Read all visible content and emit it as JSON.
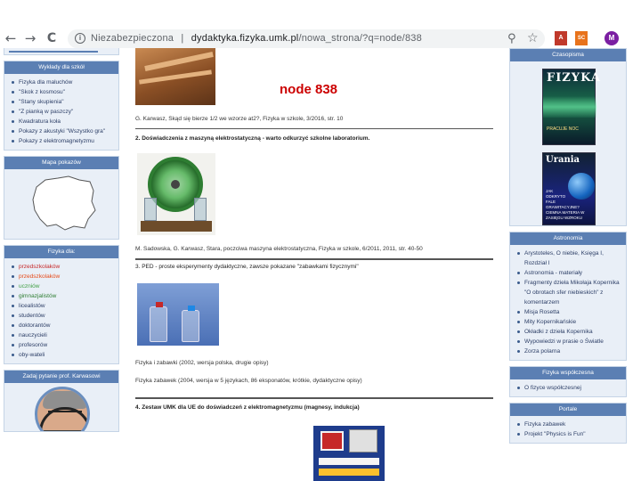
{
  "browser": {
    "nav_back": "←",
    "nav_forward": "→",
    "nav_reload": "C",
    "security_label": "Niezabezpieczona",
    "separator": "|",
    "url_host": "dydaktyka.fizyka.umk.pl",
    "url_path": "/nowa_strona/?q=node/838",
    "search_glyph": "⚲",
    "star_glyph": "☆",
    "profile_letter": "M",
    "ext1_label": "A",
    "ext2_label": "SC"
  },
  "left": {
    "wyklady": {
      "title": "Wykłady dla szkół",
      "items": [
        "Fizyka dla maluchów",
        "\"Skok z kosmosu\"",
        "\"Stany skupienia\"",
        "\"Z pianką w paszczy\"",
        "Kwadratura koła",
        "Pokazy z akustyki \"Wszystko gra\"",
        "Pokazy z elektromagnetyzmu"
      ]
    },
    "mapa": {
      "title": "Mapa pokazów"
    },
    "fizyka_dla": {
      "title": "Fizyka dla:",
      "items": [
        {
          "label": "przedszkolaków",
          "color": "#c62828"
        },
        {
          "label": "przedszkolaków",
          "color": "#e64a19"
        },
        {
          "label": "uczniów",
          "color": "#43a047"
        },
        {
          "label": "gimnazjalistów",
          "color": "#2e7d32"
        },
        {
          "label": "licealistów",
          "color": "#2c3e66"
        },
        {
          "label": "studentów",
          "color": "#2c3e66"
        },
        {
          "label": "doktorantów",
          "color": "#2c3e66"
        },
        {
          "label": "nauczycieli",
          "color": "#2c3e66"
        },
        {
          "label": "profesorów",
          "color": "#2c3e66"
        },
        {
          "label": "oby-wateli",
          "color": "#2c3e66"
        }
      ]
    },
    "pytanie": {
      "title": "Zadaj pytanie prof. Karwasowi"
    }
  },
  "main": {
    "node_title": "node 838",
    "ref1": "G. Karwasz, Skąd się bierze 1/2 we wzorze at2?, Fizyka w szkole, 3/2016, str. 10",
    "head2": "2. Doświadczenia z maszyną elektrostatyczną - warto odkurzyć szkolne laboratorium.",
    "ref2": "M. Sadowska, G. Karwasz, Stara, poczciwa maszyna elektrostatyczna, Fizyka w szkole, 6/2011, 2011, str. 40-50",
    "head3": "3. PED - proste eksperymenty dydaktyczne, zawsze pokazane \"zabawkami fizycznymi\"",
    "ref3a": "Fizyka i zabawki (2002, wersja polska, drugie opisy)",
    "ref3b": "Fizyka zabawek (2004, wersja w 5 językach, 86 eksponatów, krótkie, dydaktyczne opisy)",
    "head4": "4. Zestaw UMK dla UE do doświadczeń z elektromagnetyzmu (magnesy, indukcja)"
  },
  "right": {
    "czasopisma": {
      "title": "Czasopisma",
      "cover1_title": "FIZYKA",
      "cover1_sub": "PRACUJE NOC",
      "cover2_title": "Urania",
      "cover2_sub": "JAK ODKRYTO FALE GRAWITACYJNE?",
      "cover2_sub2": "CIEMNA MATERIA W ZASIĘGU WZROKU"
    },
    "astronomia": {
      "title": "Astronomia",
      "items": [
        "Arystoteles, O niebie, Księga I, Rozdział I",
        "Astronomia - materiały",
        "Fragmenty dzieła Mikołaja Kopernika \"O obrotach sfer niebieskich\" z komentarzem",
        "Misja Rosetta",
        "Mity Kopernikańskie",
        "Okładki z dzieła Kopernika",
        "Wypowiedzi w prasie o Światle",
        "Zorza polarna"
      ]
    },
    "fizyka_wsp": {
      "title": "Fizyka współczesna",
      "items": [
        "O fizyce współczesnej"
      ]
    },
    "portale": {
      "title": "Portale",
      "items": [
        "Fizyka zabawek",
        "Projekt \"Physics is Fun\""
      ]
    }
  },
  "colors": {
    "box_header": "#5b7fb3",
    "box_bg": "#e9eff7",
    "node_title": "#cc0000"
  }
}
